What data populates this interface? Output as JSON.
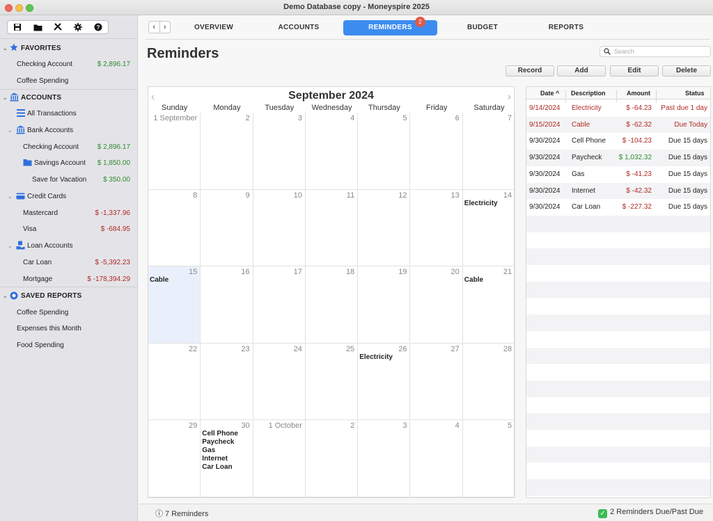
{
  "window": {
    "title": "Demo Database copy - Moneyspire 2025"
  },
  "sidebar": {
    "sections": {
      "favorites": "FAVORITES",
      "accounts": "ACCOUNTS",
      "saved_reports": "SAVED REPORTS"
    },
    "favorites": [
      {
        "label": "Checking Account",
        "amount": "$ 2,896.17"
      },
      {
        "label": "Coffee Spending",
        "amount": ""
      }
    ],
    "accounts": {
      "all_transactions": "All Transactions",
      "bank_accounts": "Bank Accounts",
      "checking": {
        "label": "Checking Account",
        "amount": "$ 2,896.17"
      },
      "savings": {
        "label": "Savings Account",
        "amount": "$ 1,850.00"
      },
      "vacation": {
        "label": "Save for Vacation",
        "amount": "$ 350.00"
      },
      "credit_cards": "Credit Cards",
      "mastercard": {
        "label": "Mastercard",
        "amount": "$ -1,337.96"
      },
      "visa": {
        "label": "Visa",
        "amount": "$ -684.95"
      },
      "loan_accounts": "Loan Accounts",
      "car_loan": {
        "label": "Car Loan",
        "amount": "$ -5,392.23"
      },
      "mortgage": {
        "label": "Mortgage",
        "amount": "$ -178,394.29"
      }
    },
    "reports": [
      "Coffee Spending",
      "Expenses this Month",
      "Food Spending"
    ]
  },
  "tabs": {
    "overview": "OVERVIEW",
    "accounts": "ACCOUNTS",
    "reminders": "REMINDERS",
    "reminders_badge": "2",
    "budget": "BUDGET",
    "reports": "REPORTS"
  },
  "page": {
    "title": "Reminders",
    "search_placeholder": "Search",
    "buttons": {
      "record": "Record",
      "add": "Add",
      "edit": "Edit",
      "delete": "Delete"
    }
  },
  "calendar": {
    "title": "September 2024",
    "days_of_week": [
      "Sunday",
      "Monday",
      "Tuesday",
      "Wednesday",
      "Thursday",
      "Friday",
      "Saturday"
    ],
    "weeks": [
      [
        "1 September",
        "2",
        "3",
        "4",
        "5",
        "6",
        "7"
      ],
      [
        "8",
        "9",
        "10",
        "11",
        "12",
        "13",
        "14"
      ],
      [
        "15",
        "16",
        "17",
        "18",
        "19",
        "20",
        "21"
      ],
      [
        "22",
        "23",
        "24",
        "25",
        "26",
        "27",
        "28"
      ],
      [
        "29",
        "30",
        "1 October",
        "2",
        "3",
        "4",
        "5"
      ]
    ],
    "events": {
      "w1d6": [
        "Electricity"
      ],
      "w2d0": [
        "Cable"
      ],
      "w2d6": [
        "Cable"
      ],
      "w3d4": [
        "Electricity"
      ],
      "w4d1": [
        "Cell Phone",
        "Paycheck",
        "Gas",
        "Internet",
        "Car Loan"
      ]
    }
  },
  "reminders_table": {
    "headers": {
      "date": "Date ^",
      "description": "Description",
      "amount": "Amount",
      "status": "Status"
    },
    "rows": [
      {
        "date": "9/14/2024",
        "description": "Electricity",
        "amount": "$ -64.23",
        "status": "Past due 1 day",
        "due": true,
        "amount_type": "neg"
      },
      {
        "date": "9/15/2024",
        "description": "Cable",
        "amount": "$ -62.32",
        "status": "Due Today",
        "due": true,
        "amount_type": "neg"
      },
      {
        "date": "9/30/2024",
        "description": "Cell Phone",
        "amount": "$ -104.23",
        "status": "Due 15 days",
        "due": false,
        "amount_type": "neg"
      },
      {
        "date": "9/30/2024",
        "description": "Paycheck",
        "amount": "$ 1,032.32",
        "status": "Due 15 days",
        "due": false,
        "amount_type": "pos"
      },
      {
        "date": "9/30/2024",
        "description": "Gas",
        "amount": "$ -41.23",
        "status": "Due 15 days",
        "due": false,
        "amount_type": "neg"
      },
      {
        "date": "9/30/2024",
        "description": "Internet",
        "amount": "$ -42.32",
        "status": "Due 15 days",
        "due": false,
        "amount_type": "neg"
      },
      {
        "date": "9/30/2024",
        "description": "Car Loan",
        "amount": "$ -227.32",
        "status": "Due 15 days",
        "due": false,
        "amount_type": "neg"
      }
    ]
  },
  "status_bar": {
    "left": "ⓘ 7 Reminders",
    "right": "2 Reminders Due/Past Due"
  },
  "colors": {
    "accent": "#3c8cf0",
    "positive": "#2e8b2e",
    "negative": "#b02a24",
    "badge": "#e05a44"
  }
}
